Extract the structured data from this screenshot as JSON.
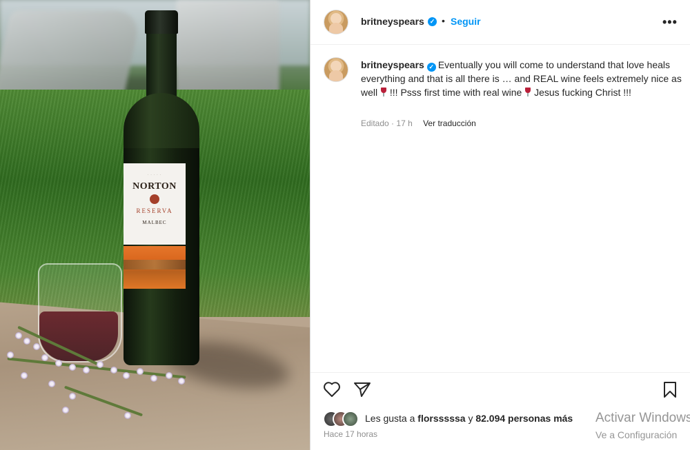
{
  "post": {
    "image_alt": "Bottle of Norton Reserva Malbec with a glass of red wine on a stone slab on the lawn",
    "bottle_label": {
      "brand": "NORTON",
      "line": "RESERVA",
      "varietal": "MALBEC"
    }
  },
  "header": {
    "username": "britneyspears",
    "verified_badge": "✓",
    "separator": "•",
    "follow_label": "Seguir",
    "more_label": "•••"
  },
  "caption": {
    "username": "britneyspears",
    "text_part1": "Eventually you will come to understand that love heals everything and that is all there is … and REAL wine feels extremely nice as well",
    "text_part2": " !!! Psss first time with real wine",
    "text_part3": " Jesus fucking Christ !!!",
    "edited_label": "Editado",
    "time_ago": "17 h",
    "translate_label": "Ver traducción"
  },
  "likes": {
    "prefix": "Les gusta a ",
    "first_user": "flor​sssssa",
    "connector": " y ",
    "others": "82.094 personas más"
  },
  "timestamp": "Hace 17 horas",
  "windows_watermark": {
    "line1": "Activar Windows",
    "line2": "Ve a Configuración"
  },
  "icons": [
    "heart-icon",
    "send-icon",
    "bookmark-icon",
    "verified-icon",
    "more-icon",
    "wine-glass-emoji-icon"
  ],
  "colors": {
    "accent": "#0095f6",
    "text": "#262626",
    "muted": "#8e8e8e"
  }
}
